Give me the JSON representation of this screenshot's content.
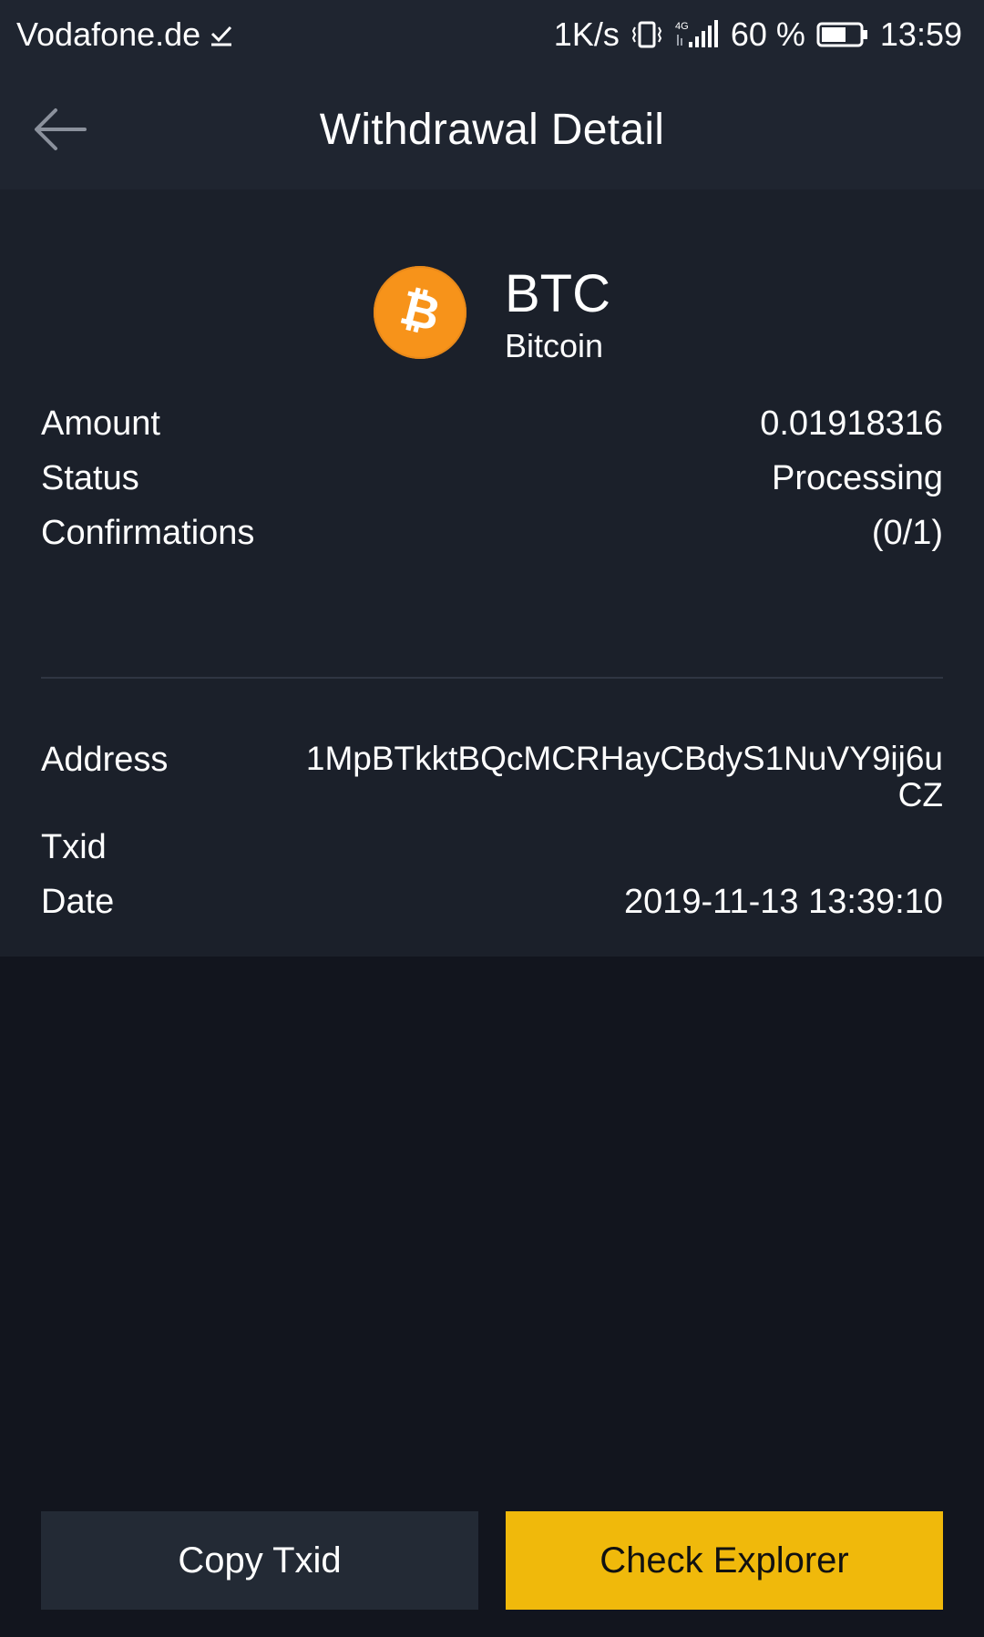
{
  "status_bar": {
    "carrier": "Vodafone.de",
    "speed": "1K/s",
    "battery": "60 %",
    "time": "13:59"
  },
  "header": {
    "title": "Withdrawal Detail"
  },
  "coin": {
    "symbol": "BTC",
    "name": "Bitcoin",
    "color": "#f7931a"
  },
  "details": {
    "amount_label": "Amount",
    "amount_value": "0.01918316",
    "status_label": "Status",
    "status_value": "Processing",
    "confirmations_label": "Confirmations",
    "confirmations_value": "(0/1)",
    "address_label": "Address",
    "address_value": "1MpBTkktBQcMCRHayCBdyS1NuVY9ij6uCZ",
    "txid_label": "Txid",
    "txid_value": "",
    "date_label": "Date",
    "date_value": "2019-11-13 13:39:10"
  },
  "buttons": {
    "copy_txid": "Copy Txid",
    "check_explorer": "Check Explorer"
  },
  "colors": {
    "accent": "#f0b90b",
    "background": "#12151e",
    "card": "#1b202a",
    "header": "#1f2530"
  }
}
